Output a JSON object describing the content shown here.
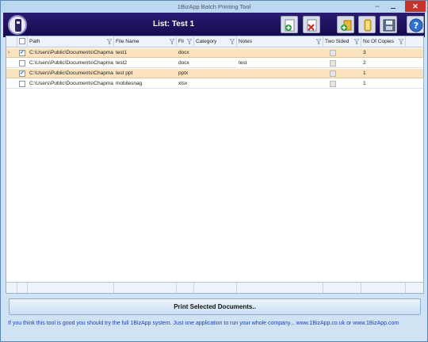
{
  "window": {
    "title": "1BizApp Batch Printing Tool",
    "close_glyph": "✕",
    "resize_glyph": "⇔"
  },
  "header": {
    "list_title": "List: Test 1"
  },
  "toolbar": [
    {
      "name": "add-document-button",
      "icon": "document-plus-icon"
    },
    {
      "name": "remove-document-button",
      "icon": "document-x-icon"
    },
    {
      "name": "add-folder-button",
      "icon": "folder-plus-icon"
    },
    {
      "name": "clear-button",
      "icon": "bin-icon"
    },
    {
      "name": "save-button",
      "icon": "floppy-disk-icon"
    },
    {
      "name": "help-button",
      "icon": "question-icon"
    }
  ],
  "columns": [
    "Path",
    "File Name",
    "Fil",
    "Category",
    "Notes",
    "Two Sided",
    "No Of Copies"
  ],
  "rows": [
    {
      "selected": true,
      "current": true,
      "checked": true,
      "path": "C:\\Users\\Public\\Documents\\Chapma",
      "file_name": "test1",
      "ext": "docx",
      "category": "",
      "notes": "",
      "two_sided": false,
      "copies": "3"
    },
    {
      "selected": false,
      "current": false,
      "checked": false,
      "path": "C:\\Users\\Public\\Documents\\Chapma",
      "file_name": "test2",
      "ext": "docx",
      "category": "",
      "notes": "test",
      "two_sided": false,
      "copies": "2"
    },
    {
      "selected": true,
      "current": false,
      "checked": true,
      "path": "C:\\Users\\Public\\Documents\\Chapma",
      "file_name": "test ppt",
      "ext": "pptx",
      "category": "",
      "notes": "",
      "two_sided": false,
      "copies": "1"
    },
    {
      "selected": false,
      "current": false,
      "checked": false,
      "path": "C:\\Users\\Public\\Documents\\Chapma",
      "file_name": "mobilesnag",
      "ext": "xlsx",
      "category": "",
      "notes": "",
      "two_sided": false,
      "copies": "1"
    }
  ],
  "actions": {
    "print_label": "Print Selected Documents.."
  },
  "footer": {
    "promo_text": "If you think this tool is good you should try the full 1BizApp system. Just one application to run your whole company... www.1BizApp.co.uk or www.1BizApp.com"
  },
  "colors": {
    "header_bg": "#1a0f5c",
    "selected_row": "#fbe3bf",
    "promo_text": "#1f3fb0"
  }
}
